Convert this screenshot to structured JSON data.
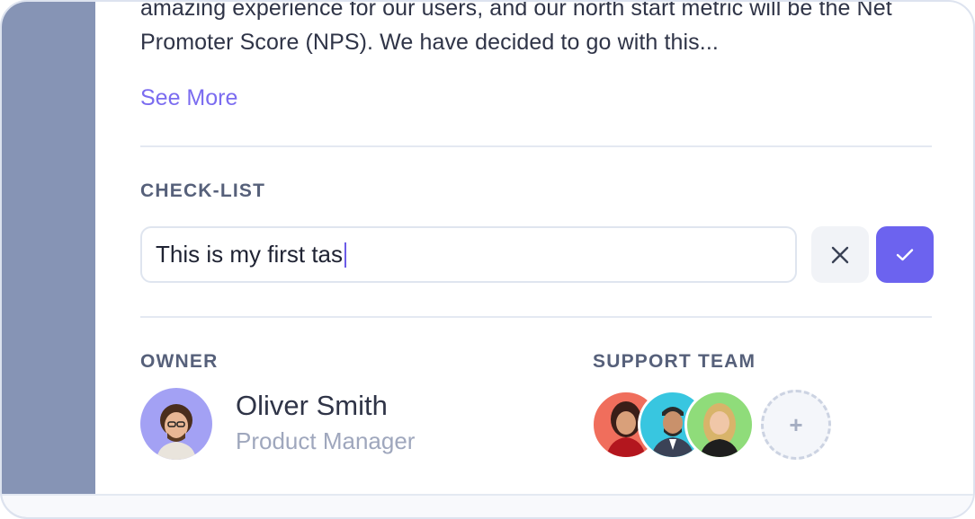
{
  "description": {
    "text": "amazing experience for our users, and our north start metric will be the Net Promoter Score (NPS). We have decided to go with this...",
    "see_more_label": "See More"
  },
  "checklist": {
    "section_label": "CHECK-LIST",
    "input_value": "This is my first tas",
    "cancel_icon": "close-icon",
    "confirm_icon": "check-icon"
  },
  "owner": {
    "section_label": "OWNER",
    "name": "Oliver Smith",
    "role": "Product Manager"
  },
  "support_team": {
    "section_label": "SUPPORT TEAM",
    "add_label": "+"
  },
  "colors": {
    "accent": "#6c63ef",
    "link": "#7b6cf0",
    "sidebar": "#8694b5"
  }
}
